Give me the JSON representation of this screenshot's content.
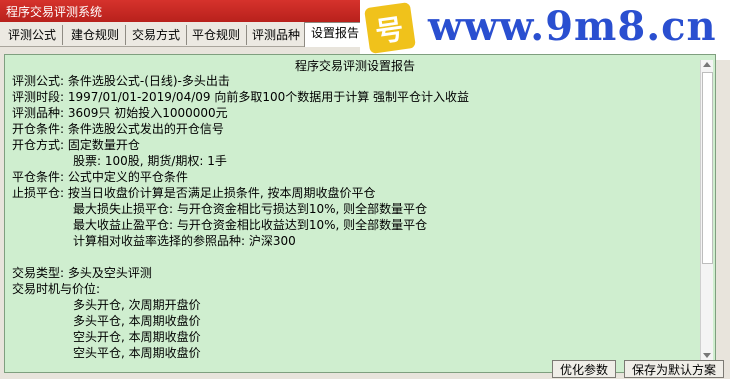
{
  "window": {
    "title": "程序交易评测系统"
  },
  "tabs": [
    {
      "label": "评测公式"
    },
    {
      "label": "建仓规则"
    },
    {
      "label": "交易方式"
    },
    {
      "label": "平仓规则"
    },
    {
      "label": "评测品种"
    },
    {
      "label": "设置报告"
    }
  ],
  "banner": {
    "site": "www.9m8.cn",
    "logo_glyph": "号"
  },
  "report": {
    "title": "程序交易评测设置报告",
    "lines": [
      "评测公式: 条件选股公式-(日线)-多头出击",
      "评测时段: 1997/01/01-2019/04/09 向前多取100个数据用于计算 强制平仓计入收益",
      "评测品种: 3609只 初始投入1000000元",
      "开仓条件: 条件选股公式发出的开仓信号",
      "开仓方式: 固定数量开仓",
      "股票: 100股, 期货/期权: 1手",
      "平仓条件: 公式中定义的平仓条件",
      "止损平仓: 按当日收盘价计算是否满足止损条件, 按本周期收盘价平仓",
      "最大损失止损平仓: 与开仓资金相比亏损达到10%, 则全部数量平仓",
      "最大收益止盈平仓: 与开仓资金相比收益达到10%, 则全部数量平仓",
      "计算相对收益率选择的参照品种: 沪深300",
      "交易类型: 多头及空头评测",
      "交易时机与价位:",
      "多头开仓, 次周期开盘价",
      "多头平仓, 本周期收盘价",
      "空头开仓, 本周期收盘价",
      "空头平仓, 本周期收盘价"
    ]
  },
  "buttons": {
    "optimize": "优化参数",
    "save_default": "保存为默认方案"
  },
  "colors": {
    "titlebar": "#c3261f",
    "panel": "#cfeecf",
    "site_text": "#2a4fd0",
    "logo": "#f0c21b"
  }
}
